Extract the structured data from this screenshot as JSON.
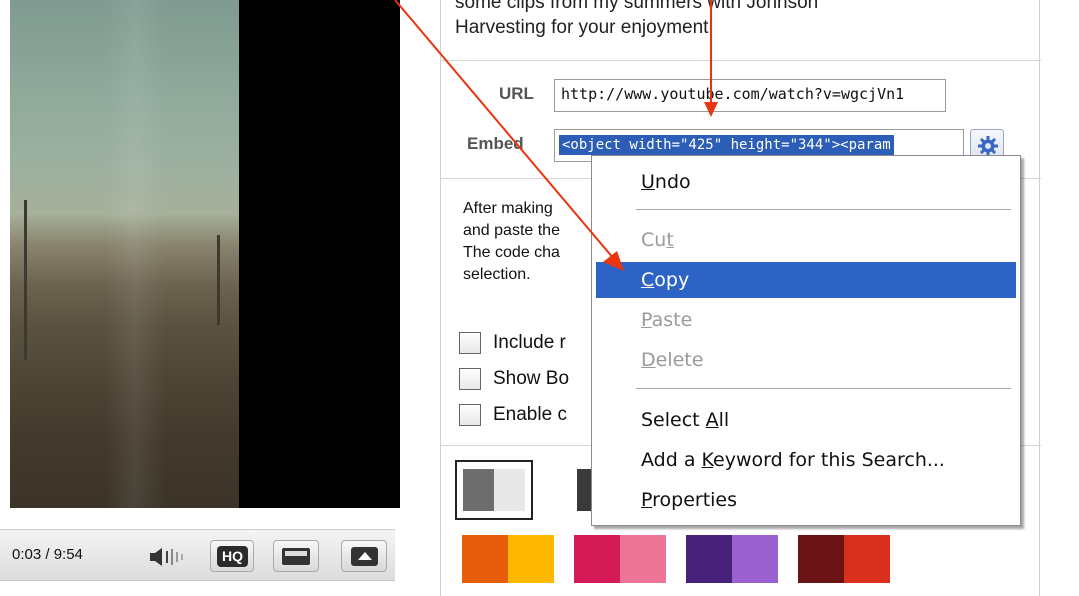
{
  "player": {
    "time": "0:03 / 9:54",
    "hq_label": "HQ",
    "volume_icon": "volume-icon",
    "size_icon": "player-size-icon",
    "fullscreen_icon": "fullscreen-icon"
  },
  "share": {
    "description_line1": "some clips from my summers with Johnson",
    "description_line2": "Harvesting for your enjoyment!",
    "url_label": "URL",
    "url_value": "http://www.youtube.com/watch?v=wgcjVn1",
    "embed_label": "Embed",
    "embed_value": "<object width=\"425\" height=\"344\"><param",
    "settings_icon": "gear-icon",
    "help_lines": [
      "After making",
      "and paste the",
      "The code cha",
      "selection."
    ],
    "options": [
      {
        "label": "Include r"
      },
      {
        "label": "Show Bo"
      },
      {
        "label": "Enable c"
      }
    ],
    "swatches": [
      {
        "colors": [
          "#6d6d6d",
          "#e8e8e8"
        ],
        "selected": true
      },
      {
        "colors": [
          "#3a3a3a"
        ],
        "selected": false
      },
      {
        "colors": [
          "#e65e0b",
          "#ffb700"
        ],
        "selected": false
      },
      {
        "colors": [
          "#d51b57",
          "#ee7497"
        ],
        "selected": false
      },
      {
        "colors": [
          "#47217a",
          "#9b61d0"
        ],
        "selected": false
      },
      {
        "colors": [
          "#6a1314",
          "#d8301d"
        ],
        "selected": false
      }
    ]
  },
  "context_menu": {
    "items": [
      {
        "pre": "",
        "key": "U",
        "post": "ndo",
        "state": "normal"
      },
      {
        "pre": "Cu",
        "key": "t",
        "post": "",
        "state": "disabled"
      },
      {
        "pre": "",
        "key": "C",
        "post": "opy",
        "state": "active"
      },
      {
        "pre": "",
        "key": "P",
        "post": "aste",
        "state": "disabled"
      },
      {
        "pre": "",
        "key": "D",
        "post": "elete",
        "state": "disabled"
      },
      {
        "pre": "Select ",
        "key": "A",
        "post": "ll",
        "state": "normal"
      },
      {
        "pre": "Add a ",
        "key": "K",
        "post": "eyword for this Search...",
        "state": "normal"
      },
      {
        "pre": "",
        "key": "P",
        "post": "roperties",
        "state": "normal"
      }
    ]
  },
  "colors": {
    "selection": "#2c5eb8",
    "menu_highlight": "#2d63c4",
    "annotation_arrow": "#e8350f"
  }
}
